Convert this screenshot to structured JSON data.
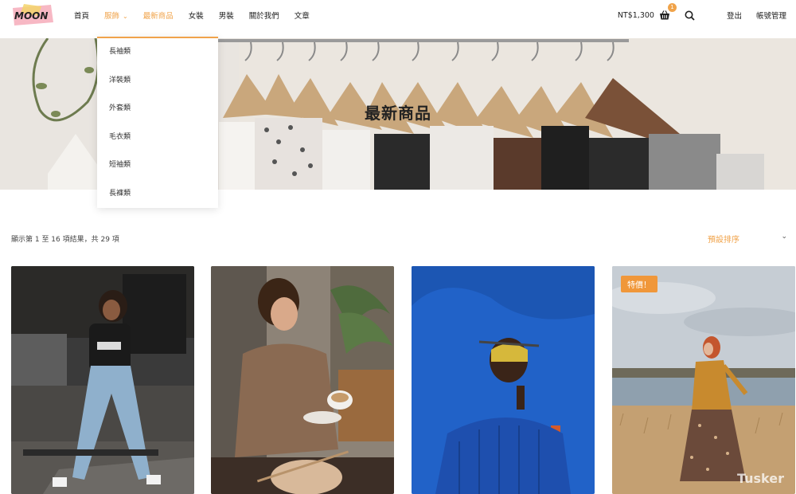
{
  "brand": {
    "logo_text": "MOON"
  },
  "nav": {
    "items": [
      {
        "label": "首頁"
      },
      {
        "label": "服飾",
        "active": true,
        "chevron": "⌄"
      },
      {
        "label": "最新商品",
        "highlight": true
      },
      {
        "label": "女裝"
      },
      {
        "label": "男裝"
      },
      {
        "label": "關於我們"
      },
      {
        "label": "文章"
      }
    ]
  },
  "header_right": {
    "cart_total": "NT$1,300",
    "cart_count": "1",
    "logout": "登出",
    "account": "帳號管理"
  },
  "hero": {
    "title": "最新商品"
  },
  "dropdown": {
    "items": [
      "長袖類",
      "洋裝類",
      "外套類",
      "毛衣類",
      "短袖類",
      "長褲類"
    ]
  },
  "results": {
    "count_text": "顯示第 1 至 16 項結果，共 29 項",
    "sort_label": "預設排序",
    "sort_chevron": "⌄"
  },
  "products": [
    {
      "badge": ""
    },
    {
      "badge": ""
    },
    {
      "badge": ""
    },
    {
      "badge": "特價！",
      "watermark": "Tusker"
    }
  ],
  "colors": {
    "accent": "#f0a34a",
    "badge": "#f0973a"
  }
}
